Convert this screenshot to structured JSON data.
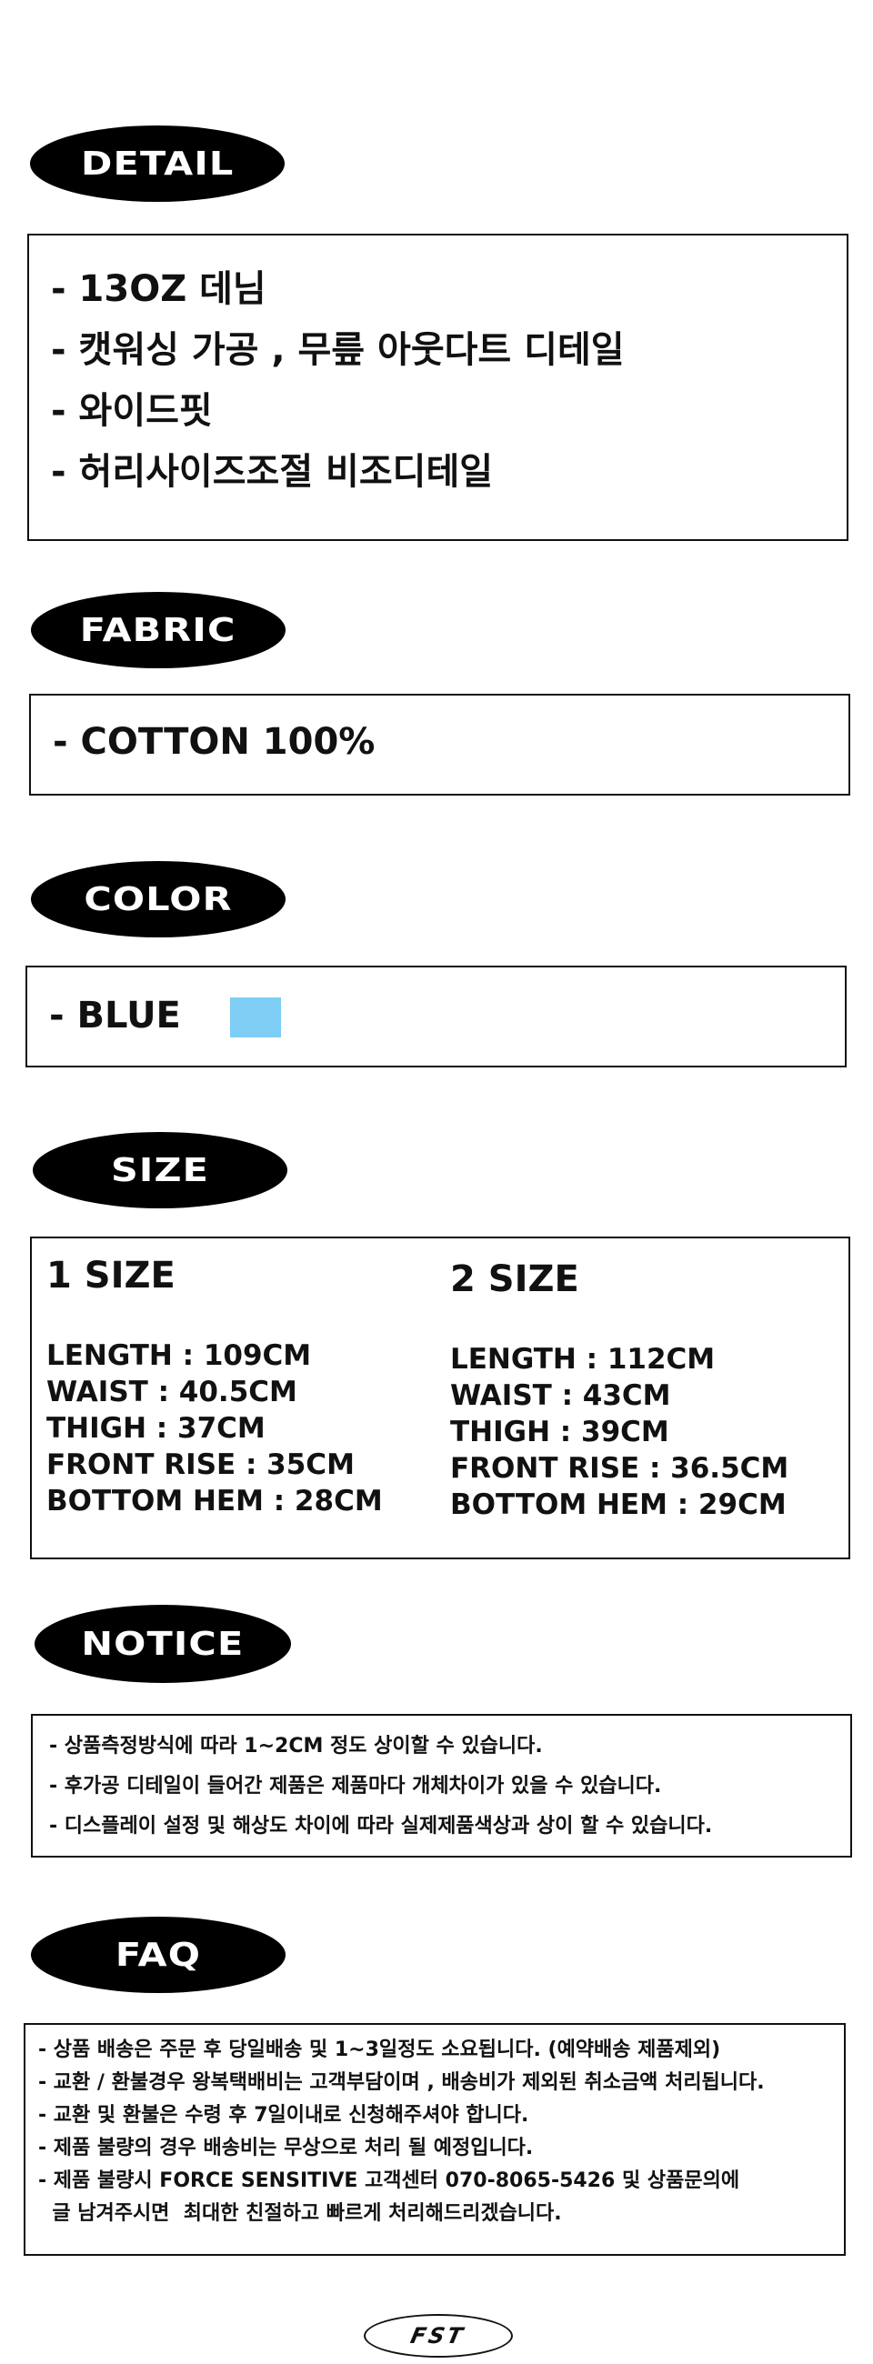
{
  "detail": {
    "heading": "DETAIL",
    "lines": [
      "- 13OZ 데님",
      "- 캣워싱 가공 , 무릎 아웃다트 디테일",
      "- 와이드핏",
      "- 허리사이즈조절 비조디테일"
    ]
  },
  "fabric": {
    "heading": "FABRIC",
    "line": "- COTTON 100%"
  },
  "color": {
    "heading": "COLOR",
    "line": "-  BLUE",
    "swatch_color": "#7dcdf5"
  },
  "size": {
    "heading": "SIZE",
    "columns": [
      {
        "title": "1 SIZE",
        "rows": [
          "LENGTH : 109CM",
          "WAIST : 40.5CM",
          "THIGH : 37CM",
          "FRONT RISE : 35CM",
          "BOTTOM HEM : 28CM"
        ]
      },
      {
        "title": "2 SIZE",
        "rows": [
          "LENGTH : 112CM",
          "WAIST : 43CM",
          "THIGH : 39CM",
          "FRONT RISE : 36.5CM",
          "BOTTOM HEM : 29CM"
        ]
      }
    ]
  },
  "notice": {
    "heading": "NOTICE",
    "lines": [
      "- 상품측정방식에 따라 1~2CM 정도 상이할 수 있습니다.",
      "- 후가공 디테일이 들어간 제품은 제품마다 개체차이가 있을 수 있습니다.",
      "- 디스플레이 설정 및 해상도 차이에 따라 실제제품색상과  상이 할 수 있습니다."
    ]
  },
  "faq": {
    "heading": "FAQ",
    "lines": [
      "- 상품 배송은 주문 후 당일배송 및 1~3일정도 소요됩니다.  (예약배송 제품제외)",
      "- 교환 / 환불경우 왕복택배비는 고객부담이며 , 배송비가 제외된 취소금액 처리됩니다.",
      "- 교환 및 환불은 수령 후 7일이내로 신청해주셔야 합니다.",
      "- 제품 불량의 경우 배송비는 무상으로 처리 될 예정입니다.",
      "- 제품 불량시 FORCE SENSITIVE 고객센터 070-8065-5426 및 상품문의에",
      "  글 남겨주시면  최대한 친절하고 빠르게 처리해드리겠습니다."
    ]
  },
  "footer": {
    "logo_text": "FST"
  }
}
